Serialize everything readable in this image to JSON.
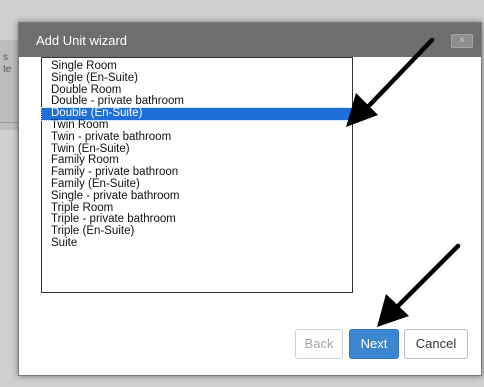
{
  "dialog": {
    "title": "Add Unit wizard",
    "close_label": "×"
  },
  "background": {
    "fragment_1": "s",
    "fragment_2": "te"
  },
  "unit_list": {
    "items": [
      "Single Room",
      "Single (En-Suite)",
      "Double Room",
      "Double - private bathroom",
      "Double (En-Suite)",
      "Twin Room",
      "Twin - private bathroom",
      "Twin (En-Suite)",
      "Family Room",
      "Family - private bathroon",
      "Family (En-Suite)",
      "Single - private bathroom",
      "Triple Room",
      "Triple - private bathroom",
      "Triple (En-Suite)",
      "Suite"
    ],
    "selected_index": 4
  },
  "buttons": {
    "back": "Back",
    "next": "Next",
    "cancel": "Cancel"
  },
  "annotations": {
    "arrow_color": "#000000"
  },
  "colors": {
    "titlebar": "#6e6e6e",
    "selection": "#1e6fd8",
    "primary_button": "#3a86d0"
  }
}
